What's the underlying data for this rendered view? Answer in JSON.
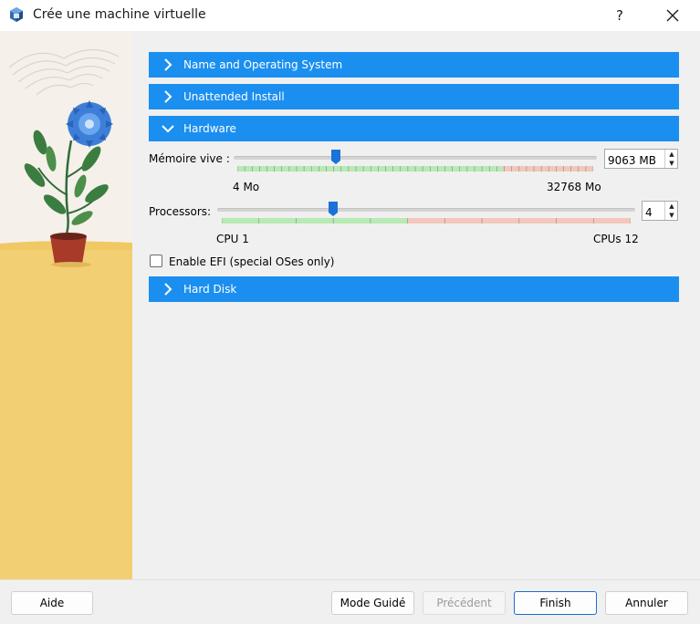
{
  "window": {
    "title": "Crée une machine virtuelle",
    "help_label": "?"
  },
  "sections": {
    "name_os": "Name and Operating System",
    "unattended": "Unattended Install",
    "hardware": "Hardware",
    "hard_disk": "Hard Disk"
  },
  "memory": {
    "label": "Mémoire vive :",
    "value": "9063 MB",
    "min_label": "4 Mo",
    "max_label": "32768 Mo",
    "min": 4,
    "max": 32768,
    "current": 9063
  },
  "processors": {
    "label": "Processors:",
    "value": "4",
    "min_label": "CPU 1",
    "max_label": "CPUs 12",
    "min": 1,
    "max": 12,
    "current": 4
  },
  "efi": {
    "label": "Enable EFI (special OSes only)",
    "checked": false
  },
  "buttons": {
    "help": "Aide",
    "guided": "Mode Guidé",
    "previous": "Précédent",
    "finish": "Finish",
    "cancel": "Annuler"
  },
  "colors": {
    "accent": "#1b8ff0",
    "scale_green": "#b7eab4",
    "scale_red": "#f3c8bc",
    "handle": "#1a73d9"
  }
}
